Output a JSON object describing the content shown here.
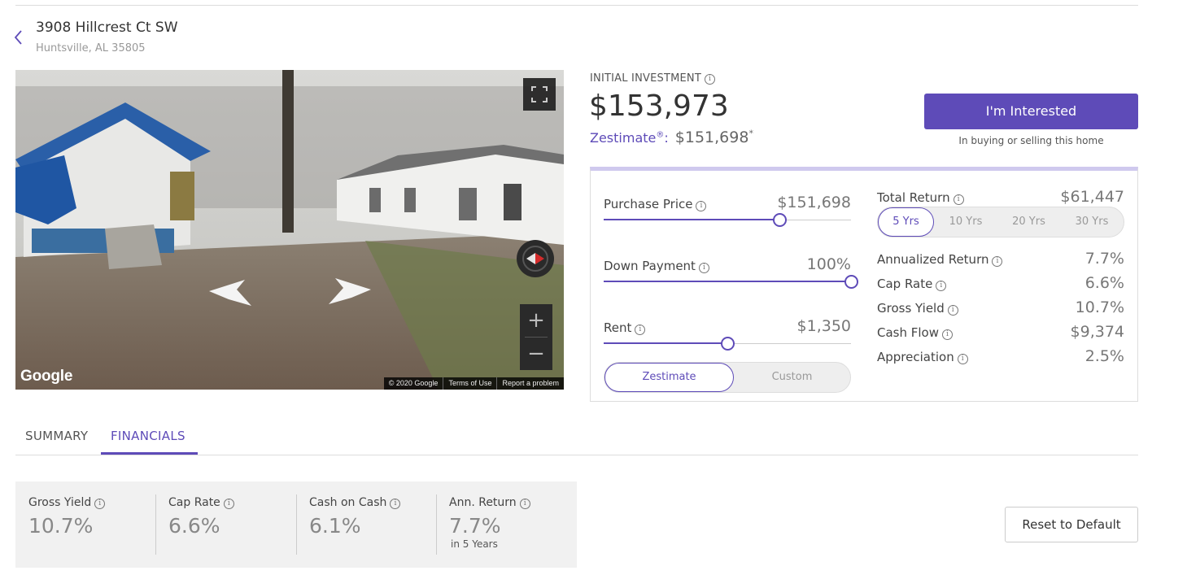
{
  "header": {
    "address_line1": "3908 Hillcrest Ct SW",
    "address_line2": "Huntsville, AL 35805"
  },
  "street_view": {
    "brand": "Google",
    "copyright": "© 2020 Google",
    "terms_label": "Terms of Use",
    "report_label": "Report a problem",
    "zoom_in_label": "+",
    "zoom_out_label": "−"
  },
  "investment": {
    "label": "INITIAL INVESTMENT",
    "amount": "$153,973",
    "zestimate_label": "Zestimate",
    "zestimate_mark": "®",
    "zestimate_sep": ":",
    "zestimate_value": "$151,698",
    "zestimate_asterisk": "*"
  },
  "cta": {
    "button_label": "I'm Interested",
    "subtext": "In buying or selling this home",
    "accent_color": "#5e4bb8"
  },
  "calculator": {
    "purchase_price": {
      "label": "Purchase Price",
      "value": "$151,698",
      "slider_fraction": 0.71
    },
    "down_payment": {
      "label": "Down Payment",
      "value": "100%",
      "slider_fraction": 1.0
    },
    "rent": {
      "label": "Rent",
      "value": "$1,350",
      "slider_fraction": 0.5,
      "modes": [
        "Zestimate",
        "Custom"
      ],
      "active_mode": "Zestimate"
    },
    "total_return": {
      "label": "Total Return",
      "value": "$61,447",
      "periods": [
        "5 Yrs",
        "10 Yrs",
        "20 Yrs",
        "30 Yrs"
      ],
      "active_period": "5 Yrs"
    },
    "stats": [
      {
        "label": "Annualized Return",
        "value": "7.7%"
      },
      {
        "label": "Cap Rate",
        "value": "6.6%"
      },
      {
        "label": "Gross Yield",
        "value": "10.7%"
      },
      {
        "label": "Cash Flow",
        "value": "$9,374"
      },
      {
        "label": "Appreciation",
        "value": "2.5%"
      }
    ]
  },
  "tabs": {
    "items": [
      "SUMMARY",
      "FINANCIALS"
    ],
    "active": "FINANCIALS"
  },
  "metrics": [
    {
      "label": "Gross Yield",
      "value": "10.7%",
      "sub": ""
    },
    {
      "label": "Cap Rate",
      "value": "6.6%",
      "sub": ""
    },
    {
      "label": "Cash on Cash",
      "value": "6.1%",
      "sub": ""
    },
    {
      "label": "Ann. Return",
      "value": "7.7%",
      "sub": "in 5 Years"
    }
  ],
  "reset_label": "Reset to Default",
  "info_glyph": "i"
}
